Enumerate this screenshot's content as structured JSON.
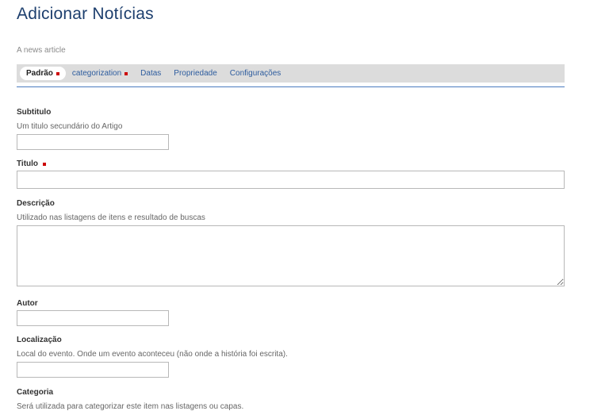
{
  "page": {
    "title": "Adicionar Notícias",
    "description": "A news article"
  },
  "tabs": [
    {
      "label": "Padrão",
      "required": true,
      "active": true
    },
    {
      "label": "categorization",
      "required": true,
      "active": false
    },
    {
      "label": "Datas",
      "required": false,
      "active": false
    },
    {
      "label": "Propriedade",
      "required": false,
      "active": false
    },
    {
      "label": "Configurações",
      "required": false,
      "active": false
    }
  ],
  "fields": {
    "subtitle": {
      "label": "Subtitulo",
      "help": "Um titulo secundário do Artigo",
      "value": ""
    },
    "title": {
      "label": "Titulo",
      "required": true,
      "value": ""
    },
    "description": {
      "label": "Descrição",
      "help": "Utilizado nas listagens de itens e resultado de buscas",
      "value": ""
    },
    "author": {
      "label": "Autor",
      "value": ""
    },
    "location": {
      "label": "Localização",
      "help": "Local do evento. Onde um evento aconteceu (não onde a história foi escrita).",
      "value": ""
    },
    "category": {
      "label": "Categoria",
      "help": "Será utilizada para categorizar este item nas listagens ou capas."
    }
  },
  "colors": {
    "title": "#1d3f6e",
    "link": "#2d5c9e",
    "required": "#cc0000",
    "tab_bar": "#dcdcdc"
  }
}
